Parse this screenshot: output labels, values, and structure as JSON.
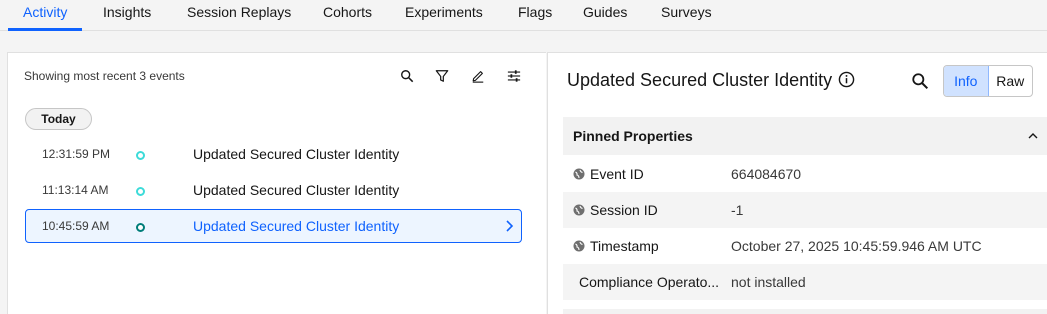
{
  "tabs": [
    {
      "label": "Activity",
      "active": true
    },
    {
      "label": "Insights"
    },
    {
      "label": "Session Replays"
    },
    {
      "label": "Cohorts"
    },
    {
      "label": "Experiments"
    },
    {
      "label": "Flags"
    },
    {
      "label": "Guides"
    },
    {
      "label": "Surveys"
    }
  ],
  "activity": {
    "summary": "Showing most recent 3 events",
    "toolbar_icons": [
      "search-icon",
      "filter-icon",
      "edit-icon",
      "settings-sliders-icon"
    ],
    "day_label": "Today",
    "events": [
      {
        "time": "12:31:59 PM",
        "name": "Updated Secured Cluster Identity",
        "selected": false
      },
      {
        "time": "11:13:14 AM",
        "name": "Updated Secured Cluster Identity",
        "selected": false
      },
      {
        "time": "10:45:59 AM",
        "name": "Updated Secured Cluster Identity",
        "selected": true
      }
    ]
  },
  "detail": {
    "title": "Updated Secured Cluster Identity",
    "view_toggle": {
      "info": "Info",
      "raw": "Raw",
      "selected": "Info"
    },
    "section_title": "Pinned Properties",
    "properties": [
      {
        "key": "Event ID",
        "value": "664084670",
        "icon": "globe-icon"
      },
      {
        "key": "Session ID",
        "value": "-1",
        "icon": "globe-icon"
      },
      {
        "key": "Timestamp",
        "value": "October 27, 2025 10:45:59.946 AM UTC",
        "icon": "globe-icon"
      },
      {
        "key": "Compliance Operato...",
        "value": "not installed",
        "icon": ""
      }
    ]
  },
  "colors": {
    "accent": "#0f62fe",
    "selected_bg": "#edf5ff",
    "dot": "#3ddbd9",
    "dot_selected": "#007d79"
  }
}
